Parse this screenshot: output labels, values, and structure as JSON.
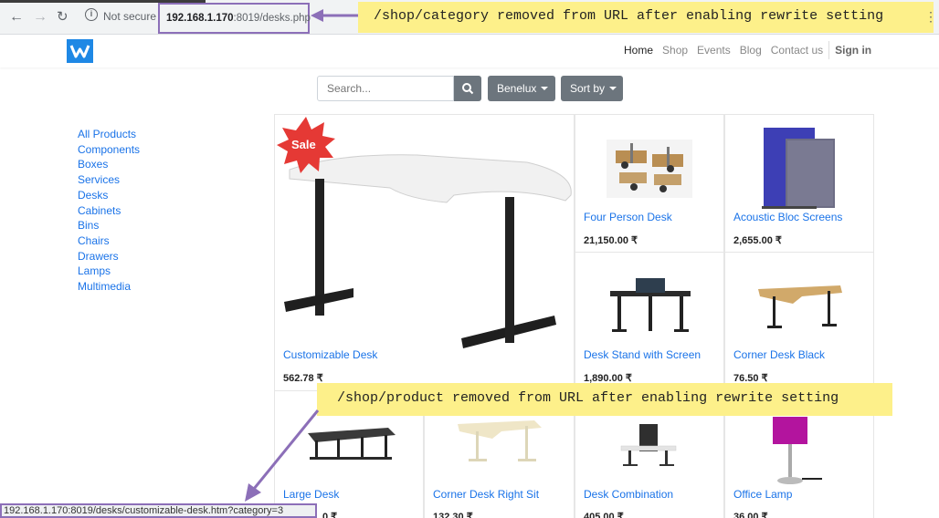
{
  "browser": {
    "not_secure_label": "Not secure",
    "url_host": "192.168.1.170",
    "url_rest": ":8019/desks.php",
    "status_url": "192.168.1.170:8019/desks/customizable-desk.htm?category=3"
  },
  "annotations": {
    "category_note": "/shop/category removed from URL after enabling rewrite setting",
    "product_note": "/shop/product removed from URL after enabling rewrite setting"
  },
  "header": {
    "logo_text": "W",
    "nav": [
      "Home",
      "Shop",
      "Events",
      "Blog",
      "Contact us"
    ],
    "signin_label": "Sign in"
  },
  "search": {
    "placeholder": "Search...",
    "pricelist_label": "Benelux",
    "sort_label": "Sort by"
  },
  "categories": [
    "All Products",
    "Components",
    "Boxes",
    "Services",
    "Desks",
    "Cabinets",
    "Bins",
    "Chairs",
    "Drawers",
    "Lamps",
    "Multimedia"
  ],
  "badge": {
    "sale_label": "Sale"
  },
  "products": [
    {
      "name": "Customizable Desk",
      "price": "562.78 ₹"
    },
    {
      "name": "Four Person Desk",
      "price": "21,150.00 ₹"
    },
    {
      "name": "Acoustic Bloc Screens",
      "price": "2,655.00 ₹"
    },
    {
      "name": "Desk Stand with Screen",
      "price": "1,890.00 ₹"
    },
    {
      "name": "Corner Desk Black",
      "price": "76.50 ₹"
    },
    {
      "name": "Large Desk",
      "price": "0 ₹"
    },
    {
      "name": "Corner Desk Right Sit",
      "price": "132.30 ₹"
    },
    {
      "name": "Desk Combination",
      "price": "405.00 ₹"
    },
    {
      "name": "Office Lamp",
      "price": "36.00 ₹"
    }
  ],
  "colors": {
    "accent_link": "#1a73e8",
    "annotation_yellow": "#fdf08a",
    "annotation_purple": "#8c6fb8",
    "sale_red": "#e53935"
  }
}
